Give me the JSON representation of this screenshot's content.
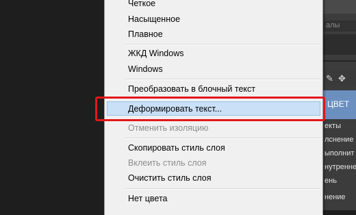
{
  "right_panel": {
    "tab_fragment": "алы",
    "selected_fragment": "ЦВЕТ",
    "items": [
      "екты",
      "лснение",
      "ыполнит",
      "нутренне",
      "ень",
      "нение"
    ],
    "tool_icons": [
      "pen-icon",
      "move-icon"
    ]
  },
  "menu": {
    "items": [
      {
        "label": "Четкое",
        "enabled": true
      },
      {
        "label": "Насыщенное",
        "enabled": true
      },
      {
        "label": "Плавное",
        "enabled": true
      },
      {
        "label": "ЖКД Windows",
        "enabled": true
      },
      {
        "label": "Windows",
        "enabled": true
      },
      {
        "label": "Преобразовать в блочный текст",
        "enabled": true
      },
      {
        "label": "Деформировать текст...",
        "enabled": true,
        "highlighted": true
      },
      {
        "label": "Отменить изоляцию",
        "enabled": false
      },
      {
        "label": "Скопировать стиль слоя",
        "enabled": true
      },
      {
        "label": "Вклеить стиль слоя",
        "enabled": false
      },
      {
        "label": "Очистить стиль слоя",
        "enabled": true
      },
      {
        "label": "Нет цвета",
        "enabled": true
      }
    ]
  },
  "colors": {
    "highlight": "#c9e0f7",
    "annotation_red": "#e4161a",
    "panel_selection": "#6b8fbf"
  }
}
